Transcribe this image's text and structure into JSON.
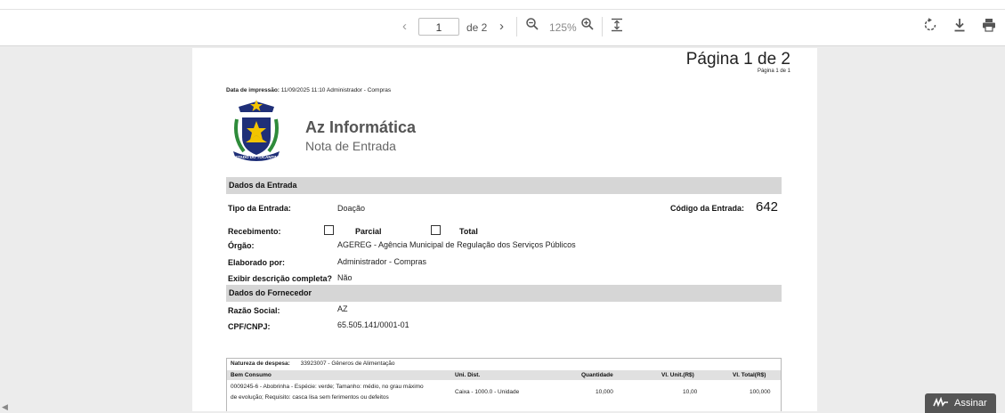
{
  "toolbar": {
    "prev_icon": "chevron-left",
    "page_current": "1",
    "page_of": "de 2",
    "next_icon": "chevron-right",
    "zoom_out_icon": "zoom-out",
    "zoom_level": "125%",
    "zoom_in_icon": "zoom-in",
    "fit_icon": "fit-to-page",
    "rotate_icon": "rotate",
    "download_icon": "download",
    "print_icon": "print"
  },
  "page": {
    "pagina_header": "Página 1 de 2",
    "pagina_sub": "Página 1 de 1",
    "print_label": "Data de impressão:",
    "print_value": "11/09/2025 11:10 Administrador - Compras",
    "seal_text": "ESTADO DO TOCANTINS",
    "company": "Az Informática",
    "doc_title": "Nota de Entrada",
    "sections": {
      "entrada": "Dados da Entrada",
      "fornecedor": "Dados do Fornecedor"
    },
    "fields": {
      "tipo_label": "Tipo da Entrada:",
      "tipo_value": "Doação",
      "codigo_label": "Código da Entrada:",
      "codigo_value": "642",
      "recebimento_label": "Recebimento:",
      "parcial": "Parcial",
      "total": "Total",
      "orgao_label": "Órgão:",
      "orgao_value": "AGEREG - Agência Municipal de Regulação dos Serviços Públicos",
      "elaborado_label": "Elaborado por:",
      "elaborado_value": "Administrador - Compras",
      "exibir_label": "Exibir descrição completa?",
      "exibir_value": "Não",
      "razao_label": "Razão Social:",
      "razao_value": "AZ",
      "cpf_label": "CPF/CNPJ:",
      "cpf_value": "65.505.141/0001-01"
    },
    "table": {
      "natureza_label": "Natureza de despesa:",
      "natureza_value": "33923007 - Gêneros de Alimentação",
      "headers": [
        "Bem Consumo",
        "Uni. Dist.",
        "Quantidade",
        "Vl. Unit.(R$)",
        "Vl. Total(R$)"
      ],
      "row": {
        "desc1": "0009245-6 - Abobrinha - Espécie: verde; Tamanho: médio, no grau máximo",
        "desc2": "de evolução; Requisito: casca lisa sem ferimentos ou defeitos",
        "uni": "Caixa - 1000.0 - Unidade",
        "qtd": "10,000",
        "unit": "10,00",
        "total": "100,000"
      }
    }
  },
  "assinar": "Assinar",
  "colors": {
    "toolbar_bg": "#ffffff",
    "viewer_bg": "#ececec",
    "section_bar": "#d6d6d6",
    "seal_blue": "#1f2f78",
    "seal_green": "#2e8b3a",
    "seal_gold": "#f2c400"
  }
}
